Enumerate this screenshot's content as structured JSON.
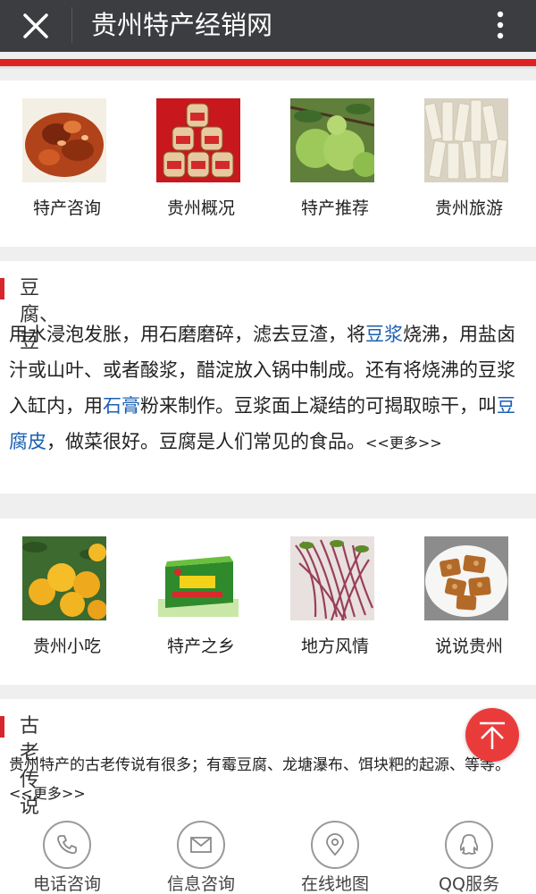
{
  "header": {
    "title": "贵州特产经销网",
    "close_icon": "close-icon",
    "more_icon": "more-vertical-icon"
  },
  "grid1": [
    {
      "label": "特产咨询",
      "image": "braised-pork-dish"
    },
    {
      "label": "贵州概况",
      "image": "jars-of-preserves"
    },
    {
      "label": "特产推荐",
      "image": "pomelo-fruits"
    },
    {
      "label": "贵州旅游",
      "image": "white-rice-noodles"
    }
  ],
  "section1": {
    "title": "豆腐、豆",
    "body": [
      {
        "text": "用水浸泡发胀，用石磨磨碎，滤去豆渣，将"
      },
      {
        "text": "豆浆",
        "link": true
      },
      {
        "text": "烧沸，用盐卤汁或山叶、或者酸浆，醋淀放入锅中制成。还有将烧沸的豆浆入缸内，用"
      },
      {
        "text": "石膏",
        "link": true
      },
      {
        "text": "粉来制作。豆浆面上凝结的可揭取晾干，叫"
      },
      {
        "text": "豆腐皮",
        "link": true
      },
      {
        "text": "，做菜很好。豆腐是人们常见的食品。"
      }
    ],
    "more": "<<更多>>"
  },
  "grid2": [
    {
      "label": "贵州小吃",
      "image": "oranges-on-tree"
    },
    {
      "label": "特产之乡",
      "image": "huanghuacai-gift-box"
    },
    {
      "label": "地方风情",
      "image": "red-stemmed-vegetables"
    },
    {
      "label": "说说贵州",
      "image": "walnut-candy-plate"
    }
  ],
  "section2": {
    "title": "古老传说",
    "body": "贵州特产的古老传说有很多；有霉豆腐、龙塘瀑布、饵块粑的起源、等等。",
    "more": "<<更多>>"
  },
  "bottom_nav": [
    {
      "label": "电话咨询",
      "icon": "phone-icon"
    },
    {
      "label": "信息咨询",
      "icon": "envelope-icon"
    },
    {
      "label": "在线地图",
      "icon": "map-pin-icon"
    },
    {
      "label": "QQ服务",
      "icon": "qq-penguin-icon"
    }
  ],
  "back_to_top_icon": "arrow-up-icon",
  "colors": {
    "accent": "#e02020",
    "link": "#1a5fb4",
    "header_bg": "#3b3d41",
    "section_bar": "#d8262d"
  }
}
